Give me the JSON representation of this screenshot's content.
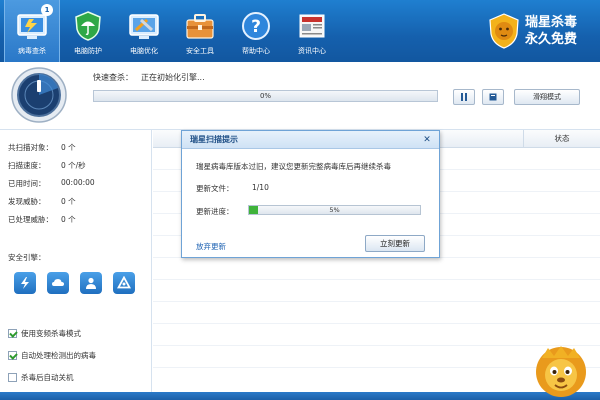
{
  "nav": {
    "items": [
      {
        "label": "病毒查杀",
        "icon": "virus-scan-icon",
        "active": true,
        "badge": "1"
      },
      {
        "label": "电脑防护",
        "icon": "shield-umbrella-icon"
      },
      {
        "label": "电脑优化",
        "icon": "optimize-tools-icon"
      },
      {
        "label": "安全工具",
        "icon": "toolbox-icon"
      },
      {
        "label": "帮助中心",
        "icon": "help-icon"
      },
      {
        "label": "资讯中心",
        "icon": "news-icon"
      }
    ]
  },
  "brand": {
    "line1": "瑞星杀毒",
    "line2": "永久免费",
    "icon": "lion-logo-icon"
  },
  "scan": {
    "mode_label": "快速查杀：",
    "status_text": "正在初始化引擎...",
    "progress": 0,
    "progress_text": "0%",
    "mode_button": "滑翔模式"
  },
  "stats": [
    {
      "label": "共扫描对象：",
      "value": "0 个"
    },
    {
      "label": "扫描速度：",
      "value": "0 个/秒"
    },
    {
      "label": "已用时间：",
      "value": "00:00:00"
    },
    {
      "label": "发现威胁：",
      "value": "0 个"
    },
    {
      "label": "已处理威胁：",
      "value": "0 个"
    }
  ],
  "engines": {
    "label": "安全引擎：",
    "icons": [
      "lightning-engine-icon",
      "cloud-engine-icon",
      "user-engine-icon",
      "recycle-engine-icon"
    ]
  },
  "options": [
    {
      "label": "使用变频杀毒模式",
      "checked": true
    },
    {
      "label": "自动处理检测出的病毒",
      "checked": true
    },
    {
      "label": "杀毒后自动关机",
      "checked": false
    }
  ],
  "table": {
    "status_header": "状态"
  },
  "dialog": {
    "title": "瑞星扫描提示",
    "message": "瑞星病毒库版本过旧，建议您更新完整病毒库后再继续杀毒",
    "files_label": "更新文件：",
    "files_value": "1/10",
    "progress_label": "更新进度：",
    "progress": 5,
    "progress_text": "5%",
    "skip_link": "放弃更新",
    "update_button": "立刻更新"
  },
  "colors": {
    "toolbar": "#1560ad",
    "progress": "#3fb33a",
    "link": "#1f63b3"
  }
}
